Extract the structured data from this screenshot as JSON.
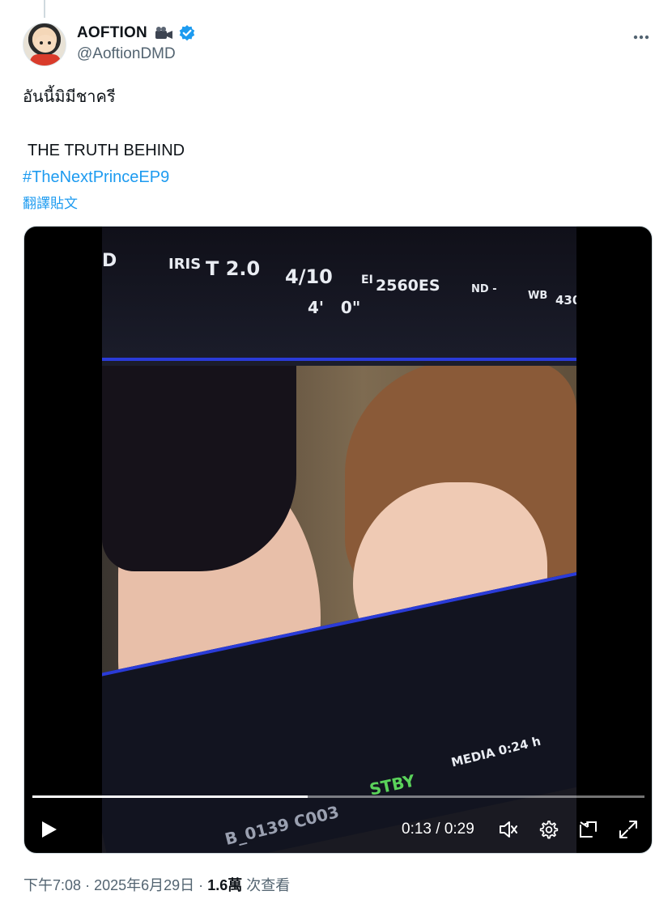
{
  "author": {
    "display_name": "AOFTION",
    "handle": "@AoftionDMD",
    "badges": [
      "movie-camera-emoji",
      "verified-badge"
    ],
    "verified_color": "#1d9bf0"
  },
  "tweet": {
    "lines": {
      "thai": "อันนี้มิมีชาครี",
      "title": "THE TRUTH BEHIND",
      "hashtag": "#TheNextPrinceEP9"
    },
    "translate_label": "翻譯貼文"
  },
  "video": {
    "current_time": "0:13",
    "duration": "0:29",
    "time_label": "0:13 / 0:29",
    "progress_fraction": 0.45,
    "osd": {
      "iris_label": "IRIS",
      "iris_value": "T 2.0",
      "fraction": "4/10",
      "ei_label": "EI",
      "ei_value": "2560ES",
      "nd": "ND -",
      "wb": "WB",
      "wb_value": "430",
      "distance": "4'   0\"",
      "stby": "STBY",
      "media": "MEDIA 0:24 h",
      "clip": "B_0139  C003",
      "left_mark": "D"
    }
  },
  "meta": {
    "time": "下午7:08",
    "separator": "·",
    "date": "2025年6月29日",
    "views_count": "1.6萬",
    "views_label": "次查看"
  },
  "icons": {
    "more": "more-icon",
    "play": "play-icon",
    "volume": "volume-icon",
    "settings": "gear-icon",
    "pip": "picture-in-picture-icon",
    "fullscreen": "fullscreen-icon"
  }
}
